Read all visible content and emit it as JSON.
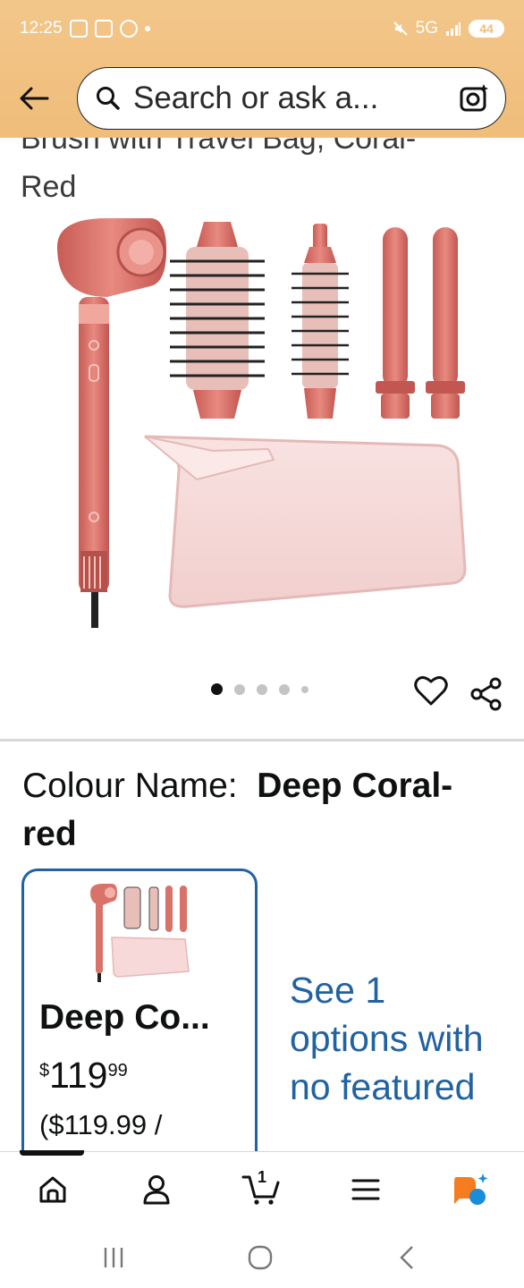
{
  "status_bar": {
    "time": "12:25",
    "network": "5G",
    "battery": "44"
  },
  "header": {
    "search_placeholder": "Search or ask a..."
  },
  "product": {
    "title_fragment_top": "Brush with Travel Bag, Coral-",
    "title_fragment_bottom": "Red",
    "image_count": 5,
    "active_image_index": 0
  },
  "colour": {
    "label": "Colour Name:",
    "value": "Deep Coral-red",
    "value_line1": "Deep Coral-",
    "value_line2": "red"
  },
  "swatch": {
    "name": "Deep Co...",
    "price_currency": "$",
    "price_whole": "119",
    "price_fraction": "99",
    "unit_price": "($119.99 /"
  },
  "see_options": {
    "text": "See 1 options with no featured"
  },
  "bottom_nav": {
    "items": [
      "home-icon",
      "account-icon",
      "cart-icon",
      "menu-icon",
      "rufus-icon"
    ],
    "cart_count": "1",
    "active_index": 0
  },
  "colors": {
    "header_bg": "#f0bd7a",
    "link_blue": "#2162a1",
    "product_coral": "#d9736a",
    "bag_pink": "#f6d9d8"
  }
}
